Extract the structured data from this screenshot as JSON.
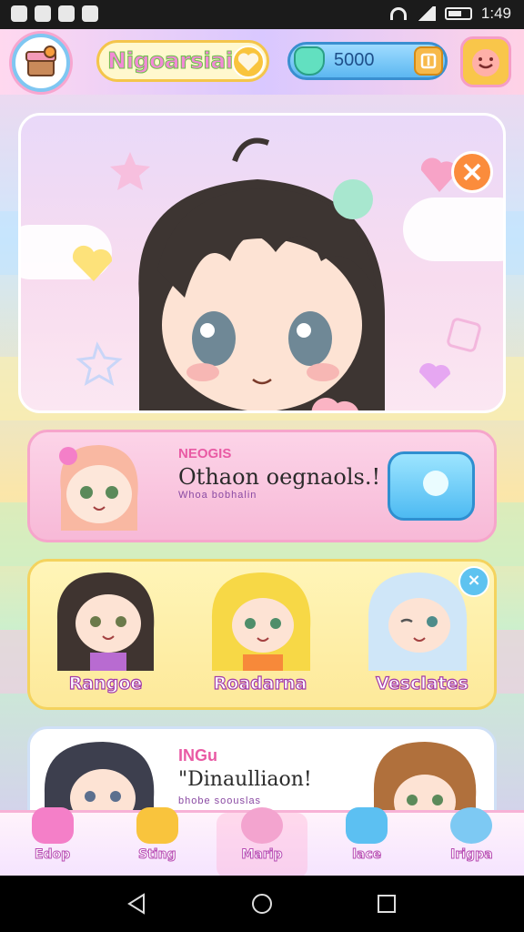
{
  "status_bar": {
    "time": "1:49"
  },
  "header": {
    "title": "Nigoarsiai",
    "currency": "5000"
  },
  "feature_panel": {
    "badge": "NEOGIS",
    "headline": "Othaon oegnaols.!",
    "subline": "Whoa bobhalin"
  },
  "roster": [
    {
      "name": "Rangoe"
    },
    {
      "name": "Roadarna"
    },
    {
      "name": "Vesclates"
    }
  ],
  "second_panel": {
    "badge": "INGu",
    "headline": "\"Dinaulliaon!",
    "subline": "bhobe soouslas"
  },
  "bottom_nav": [
    {
      "label": "Edop",
      "icon": "home-icon",
      "color": "#f47fc8"
    },
    {
      "label": "Sting",
      "icon": "star-cat-icon",
      "color": "#f9c43d"
    },
    {
      "label": "Marip",
      "icon": "character-icon",
      "color": "#f3a4cf"
    },
    {
      "label": "lace",
      "icon": "chat-icon",
      "color": "#5cc0f2"
    },
    {
      "label": "Irigpa",
      "icon": "ghost-icon",
      "color": "#7dc9f3"
    }
  ],
  "colors": {
    "accent_pink": "#f28ad6",
    "accent_blue": "#5cb7f1",
    "accent_yellow": "#f9c43d",
    "close_orange": "#fb8c3c"
  }
}
